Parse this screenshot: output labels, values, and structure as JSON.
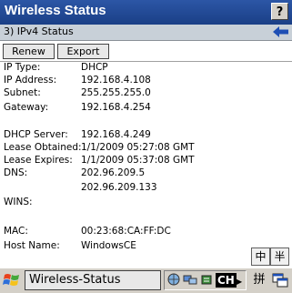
{
  "window": {
    "title": "Wireless Status",
    "help_label": "?"
  },
  "subheader": {
    "title": "3) IPv4 Status"
  },
  "toolbar": {
    "renew_label": "Renew",
    "export_label": "Export"
  },
  "fields": [
    {
      "label": "IP Type:",
      "value": "DHCP"
    },
    {
      "label": "IP Address:",
      "value": "192.168.4.108"
    },
    {
      "label": "Subnet:",
      "value": "255.255.255.0"
    },
    {
      "label": "Gateway:",
      "value": "192.168.4.254"
    },
    {
      "label": "",
      "value": ""
    },
    {
      "label": "DHCP Server:",
      "value": "192.168.4.249"
    },
    {
      "label": "Lease Obtained:",
      "value": "1/1/2009 05:27:08 GMT"
    },
    {
      "label": "Lease Expires:",
      "value": "1/1/2009 05:37:08 GMT"
    },
    {
      "label": "DNS:",
      "value": "202.96.209.5"
    },
    {
      "label": "",
      "value": "202.96.209.133"
    },
    {
      "label": "WINS:",
      "value": ""
    },
    {
      "label": "",
      "value": ""
    },
    {
      "label": "MAC:",
      "value": "00:23:68:CA:FF:DC"
    },
    {
      "label": "Host Name:",
      "value": "WindowsCE"
    }
  ],
  "ime": {
    "mode1": "中",
    "mode2": "半"
  },
  "taskbar": {
    "task_label": "Wireless-Status",
    "language_badge": "CH",
    "keyboard_label": "拼"
  },
  "icons": {
    "start": "windows-start-icon",
    "back": "back-arrow-icon",
    "tray": [
      "globe-icon",
      "network-icon",
      "wireless-icon"
    ]
  },
  "colors": {
    "titlebar": "#1a3f86",
    "subheader": "#c8d0d8"
  }
}
